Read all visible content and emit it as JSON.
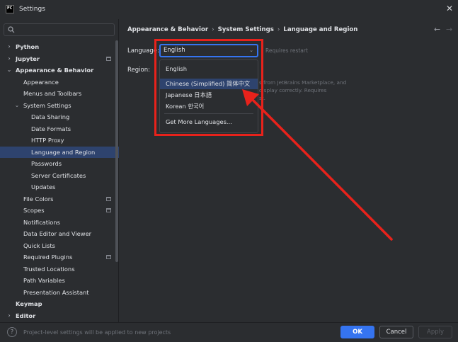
{
  "window": {
    "title": "Settings",
    "logo_text": "PC"
  },
  "sidebar": {
    "search_placeholder": "",
    "items": [
      {
        "label": "Python",
        "level": 0,
        "chevron": "›",
        "bold": true
      },
      {
        "label": "Jupyter",
        "level": 0,
        "chevron": "›",
        "bold": true,
        "project_icon": true
      },
      {
        "label": "Appearance & Behavior",
        "level": 0,
        "chevron": "⌄",
        "bold": true
      },
      {
        "label": "Appearance",
        "level": 1
      },
      {
        "label": "Menus and Toolbars",
        "level": 1
      },
      {
        "label": "System Settings",
        "level": 1,
        "chevron": "⌄"
      },
      {
        "label": "Data Sharing",
        "level": 2
      },
      {
        "label": "Date Formats",
        "level": 2
      },
      {
        "label": "HTTP Proxy",
        "level": 2
      },
      {
        "label": "Language and Region",
        "level": 2,
        "selected": true
      },
      {
        "label": "Passwords",
        "level": 2
      },
      {
        "label": "Server Certificates",
        "level": 2
      },
      {
        "label": "Updates",
        "level": 2
      },
      {
        "label": "File Colors",
        "level": 1,
        "project_icon": true
      },
      {
        "label": "Scopes",
        "level": 1,
        "project_icon": true
      },
      {
        "label": "Notifications",
        "level": 1
      },
      {
        "label": "Data Editor and Viewer",
        "level": 1
      },
      {
        "label": "Quick Lists",
        "level": 1
      },
      {
        "label": "Required Plugins",
        "level": 1,
        "project_icon": true
      },
      {
        "label": "Trusted Locations",
        "level": 1
      },
      {
        "label": "Path Variables",
        "level": 1
      },
      {
        "label": "Presentation Assistant",
        "level": 1
      },
      {
        "label": "Keymap",
        "level": 0,
        "bold": true
      },
      {
        "label": "Editor",
        "level": 0,
        "chevron": "›",
        "bold": true
      }
    ]
  },
  "main": {
    "breadcrumb": [
      "Appearance & Behavior",
      "System Settings",
      "Language and Region"
    ],
    "language_label": "Language:",
    "region_label": "Region:",
    "language_value": "English",
    "restart_note": "Requires restart",
    "hint_lines": [
      "s from JetBrains Marketplace, and",
      "display correctly. Requires",
      "st."
    ],
    "dropdown_options": [
      "English",
      "Chinese (Simplified) 简体中文",
      "Japanese 日本語",
      "Korean 한국어"
    ],
    "dropdown_more": "Get More Languages..."
  },
  "footer": {
    "help": "?",
    "note": "Project-level settings will be applied to new projects",
    "ok": "OK",
    "cancel": "Cancel",
    "apply": "Apply"
  },
  "colors": {
    "accent": "#3574f0",
    "selection": "#2e436e",
    "annotation": "#e8221b",
    "background": "#2b2d30"
  }
}
